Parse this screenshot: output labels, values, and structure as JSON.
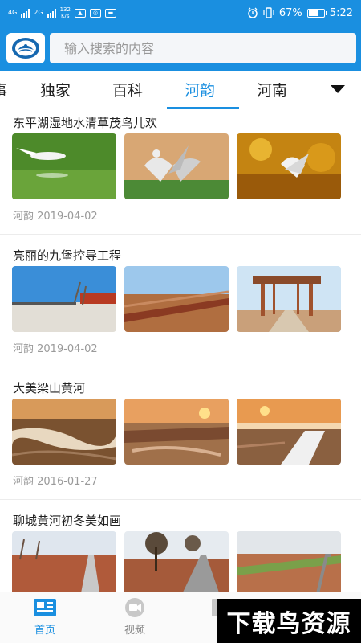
{
  "status_bar": {
    "network_left": "4G",
    "network_mid": "2G",
    "speed_value": "132",
    "speed_unit": "K/s",
    "battery": "67%",
    "time": "5:22",
    "battery_level": 0.67
  },
  "search": {
    "placeholder": "输入搜索的内容"
  },
  "tabs": [
    "事",
    "独家",
    "百科",
    "河韵",
    "河南"
  ],
  "active_tab": "河韵",
  "articles": [
    {
      "title": "东平湖湿地水清草茂鸟儿欢",
      "meta": "河韵 2019-04-02"
    },
    {
      "title": "亮丽的九堡控导工程",
      "meta": "河韵 2019-04-02"
    },
    {
      "title": "大美梁山黄河",
      "meta": "河韵 2016-01-27"
    },
    {
      "title": "聊城黄河初冬美如画",
      "meta": ""
    }
  ],
  "bottom_nav": [
    {
      "label": "首页",
      "icon": "news-icon"
    },
    {
      "label": "视频",
      "icon": "video-icon"
    },
    {
      "label": "",
      "icon": "bookmark-icon"
    }
  ],
  "watermark": "下载鸟资源",
  "colors": {
    "brand_blue": "#1a8fe0",
    "meta_gray": "#9a9a9a"
  }
}
